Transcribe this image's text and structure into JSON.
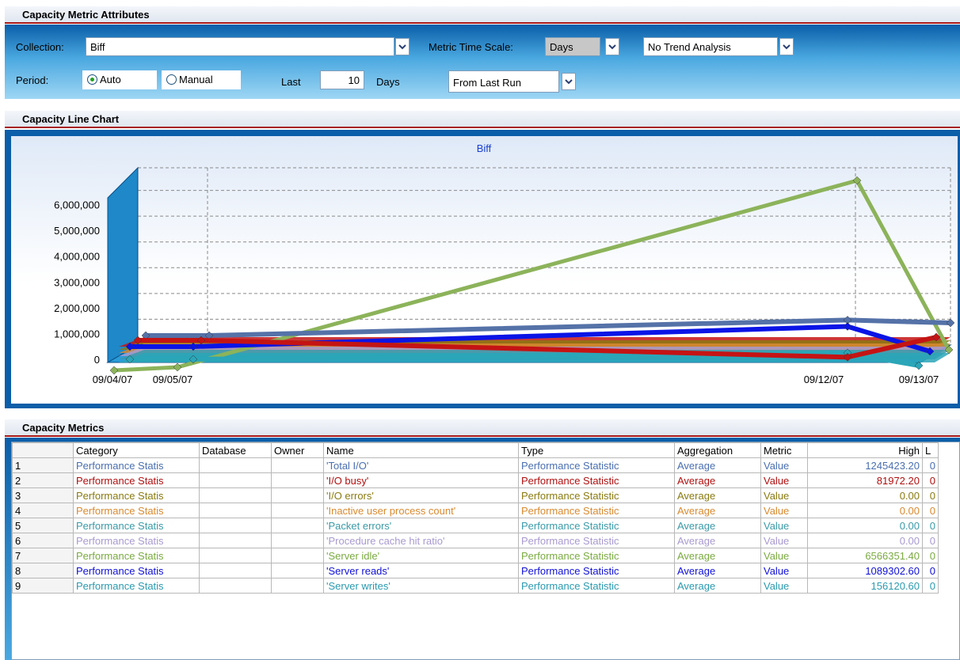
{
  "attributes": {
    "header": "Capacity Metric Attributes",
    "collection_label": "Collection:",
    "collection_value": "Biff",
    "time_scale_label": "Metric Time Scale:",
    "time_scale_value": "Days",
    "trend_value": "No Trend Analysis",
    "period_label": "Period:",
    "auto_label": "Auto",
    "manual_label": "Manual",
    "period_selected": "Auto",
    "last_label": "Last",
    "last_value": "10",
    "days_label": "Days",
    "from_value": "From Last Run"
  },
  "chart_section": {
    "header": "Capacity Line Chart"
  },
  "chart_data": {
    "type": "line",
    "title": "Biff",
    "x": [
      "09/04/07",
      "09/05/07",
      "09/12/07",
      "09/13/07"
    ],
    "yticks": [
      0,
      1000000,
      2000000,
      3000000,
      4000000,
      5000000,
      6000000
    ],
    "ytick_labels": [
      "0",
      "1,000,000",
      "2,000,000",
      "3,000,000",
      "4,000,000",
      "5,000,000",
      "6,000,000"
    ],
    "ylim": [
      0,
      7000000
    ],
    "grid": true,
    "series": [
      {
        "name": "'Server idle'",
        "color": "#8cb35a",
        "values": [
          0,
          0,
          6566351.4,
          0
        ]
      },
      {
        "name": "'Total I/O'",
        "color": "#5572a8",
        "values": [
          0,
          0,
          1245423.2,
          800000
        ]
      },
      {
        "name": "'Server reads'",
        "color": "#0a14e6",
        "values": [
          0,
          0,
          1089302.6,
          0
        ]
      },
      {
        "name": "'Server writes'",
        "color": "#2aa6b8",
        "values": [
          0,
          0,
          156120.6,
          0
        ]
      },
      {
        "name": "'I/O busy'",
        "color": "#c41414",
        "values": [
          0,
          0,
          81972.2,
          0
        ]
      }
    ]
  },
  "metrics": {
    "header": "Capacity Metrics",
    "columns": [
      "Category",
      "Database",
      "Owner",
      "Name",
      "Type",
      "Aggregation",
      "Metric",
      "High",
      "L"
    ],
    "rows": [
      {
        "n": "1",
        "color": "#4a6fb0",
        "category": "Performance Statis",
        "database": "",
        "owner": "",
        "name": "'Total I/O'",
        "type": "Performance Statistic",
        "aggregation": "Average",
        "metric": "Value",
        "high": "1245423.20",
        "low": "0"
      },
      {
        "n": "2",
        "color": "#b01010",
        "category": "Performance Statis",
        "database": "",
        "owner": "",
        "name": "'I/O busy'",
        "type": "Performance Statistic",
        "aggregation": "Average",
        "metric": "Value",
        "high": "81972.20",
        "low": "0"
      },
      {
        "n": "3",
        "color": "#8a7a10",
        "category": "Performance Statis",
        "database": "",
        "owner": "",
        "name": "'I/O errors'",
        "type": "Performance Statistic",
        "aggregation": "Average",
        "metric": "Value",
        "high": "0.00",
        "low": "0"
      },
      {
        "n": "4",
        "color": "#d88a30",
        "category": "Performance Statis",
        "database": "",
        "owner": "",
        "name": "'Inactive user process count'",
        "type": "Performance Statistic",
        "aggregation": "Average",
        "metric": "Value",
        "high": "0.00",
        "low": "0"
      },
      {
        "n": "5",
        "color": "#3a9aa8",
        "category": "Performance Statis",
        "database": "",
        "owner": "",
        "name": "'Packet errors'",
        "type": "Performance Statistic",
        "aggregation": "Average",
        "metric": "Value",
        "high": "0.00",
        "low": "0"
      },
      {
        "n": "6",
        "color": "#a89ad0",
        "category": "Performance Statis",
        "database": "",
        "owner": "",
        "name": "'Procedure cache hit ratio'",
        "type": "Performance Statistic",
        "aggregation": "Average",
        "metric": "Value",
        "high": "0.00",
        "low": "0"
      },
      {
        "n": "7",
        "color": "#7aaa40",
        "category": "Performance Statis",
        "database": "",
        "owner": "",
        "name": "'Server idle'",
        "type": "Performance Statistic",
        "aggregation": "Average",
        "metric": "Value",
        "high": "6566351.40",
        "low": "0"
      },
      {
        "n": "8",
        "color": "#1010d8",
        "category": "Performance Statis",
        "database": "",
        "owner": "",
        "name": "'Server reads'",
        "type": "Performance Statistic",
        "aggregation": "Average",
        "metric": "Value",
        "high": "1089302.60",
        "low": "0"
      },
      {
        "n": "9",
        "color": "#2a9ab0",
        "category": "Performance Statis",
        "database": "",
        "owner": "",
        "name": "'Server writes'",
        "type": "Performance Statistic",
        "aggregation": "Average",
        "metric": "Value",
        "high": "156120.60",
        "low": "0"
      }
    ]
  }
}
